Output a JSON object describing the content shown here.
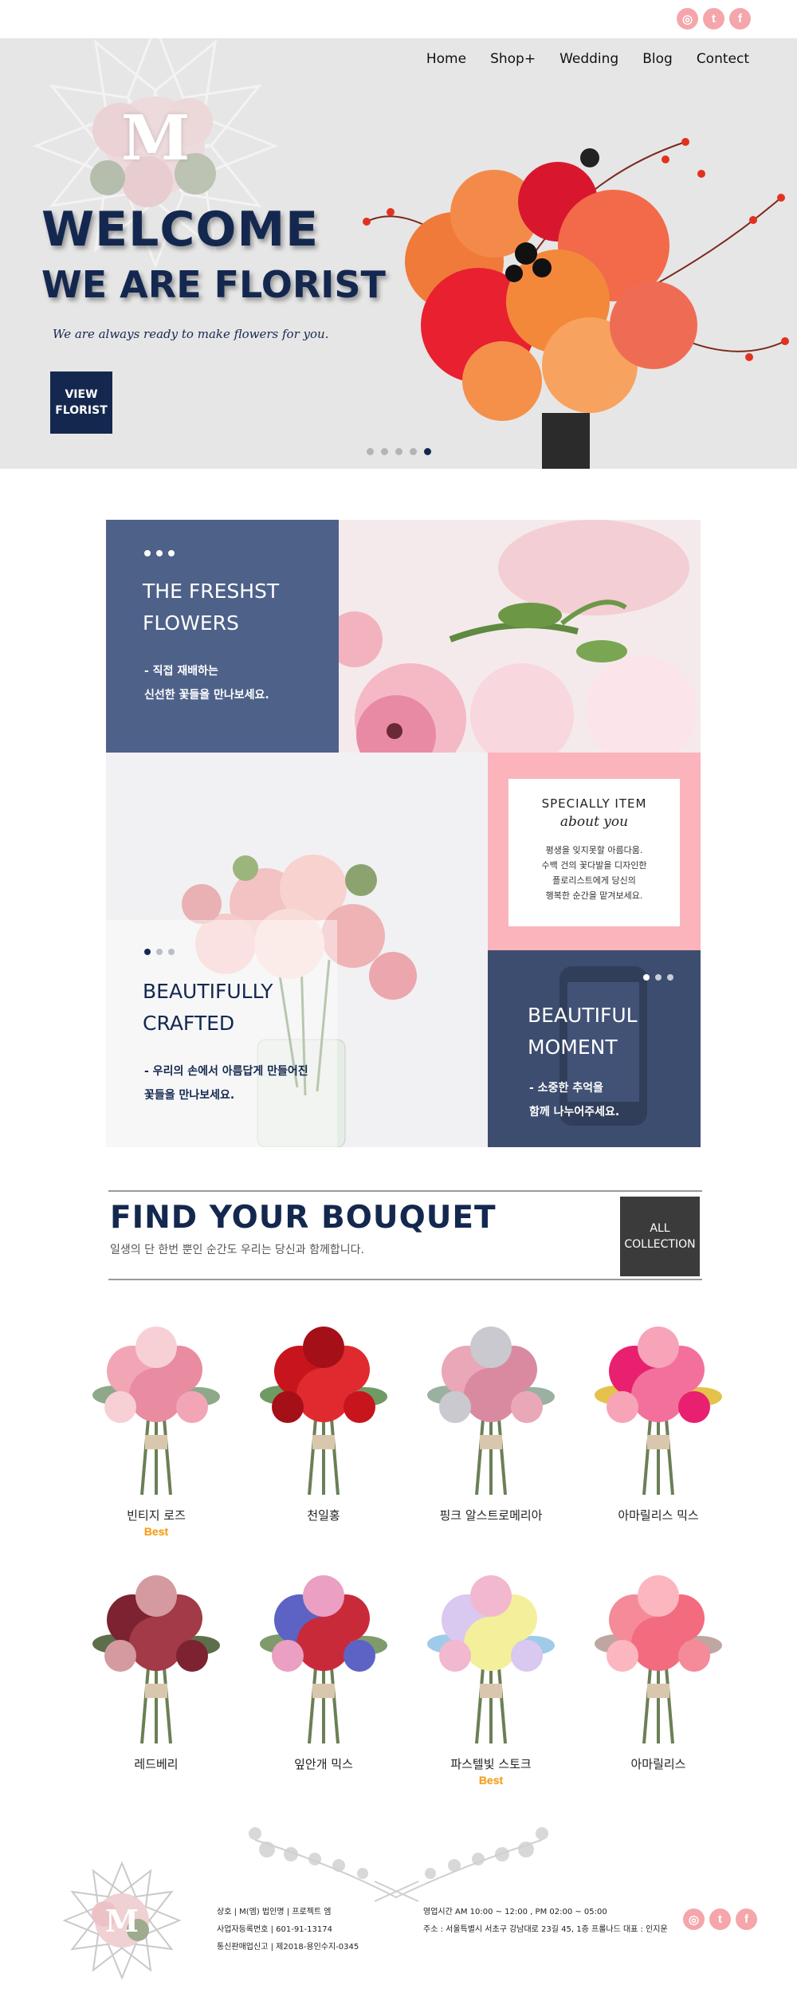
{
  "topbar": {
    "social": [
      {
        "name": "instagram-icon",
        "glyph": "◎"
      },
      {
        "name": "twitter-icon",
        "glyph": "t"
      },
      {
        "name": "facebook-icon",
        "glyph": "f"
      }
    ]
  },
  "hero": {
    "logo_letter": "M",
    "nav": [
      "Home",
      "Shop+",
      "Wedding",
      "Blog",
      "Contect"
    ],
    "title_line1": "WELCOME",
    "title_line2": "WE ARE FLORIST",
    "subtitle": "We are always ready to make flowers for you.",
    "button_line1": "VIEW",
    "button_line2": "FLORIST",
    "slides": 5,
    "active_slide": 5
  },
  "features": {
    "freshest": {
      "title_line1": "THE FRESHST",
      "title_line2": "FLOWERS",
      "text_line1": "- 직접 재배하는",
      "text_line2": "신선한 꽃들을 만나보세요."
    },
    "special": {
      "title": "SPECIALLY ITEM",
      "script": "about you",
      "text_line1": "평생을 잊지못할 아름다움.",
      "text_line2": "수백 건의 꽃다발을 디자인한",
      "text_line3": "플로리스트에게 당신의",
      "text_line4": "행복한 순간을 맡겨보세요."
    },
    "crafted": {
      "title_line1": "BEAUTIFULLY",
      "title_line2": "CRAFTED",
      "text_line1": "- 우리의 손에서 아름답게 만들어진",
      "text_line2": "꽃들을 만나보세요."
    },
    "moment": {
      "title_line1": "BEAUTIFUL",
      "title_line2": "MOMENT",
      "text_line1": "- 소중한 추억을",
      "text_line2": "함께 나누어주세요."
    }
  },
  "bouquet_section": {
    "title": "FIND YOUR BOUQUET",
    "subtitle": "일생의 단 한번 뿐인 순간도 우리는 당신과 함께합니다.",
    "button_line1": "ALL",
    "button_line2": "COLLECTION"
  },
  "products": [
    {
      "name": "빈티지 로즈",
      "badge": "Best",
      "colors": [
        "#f2a5b5",
        "#e98ca1",
        "#f7d0d6",
        "#8fa88a"
      ]
    },
    {
      "name": "천일홍",
      "badge": "",
      "colors": [
        "#c8141d",
        "#e02a2f",
        "#a50f18",
        "#6f9a63"
      ]
    },
    {
      "name": "핑크 알스트로메리아",
      "badge": "",
      "colors": [
        "#e9a7b8",
        "#d98aa0",
        "#c9c9cf",
        "#9bb0a0"
      ]
    },
    {
      "name": "아마릴리스 믹스",
      "badge": "",
      "colors": [
        "#e8206f",
        "#f3709c",
        "#f7a3b8",
        "#e4c24b"
      ]
    },
    {
      "name": "레드베리",
      "badge": "",
      "colors": [
        "#7d2231",
        "#a23a47",
        "#d59aa0",
        "#5d6e4b"
      ]
    },
    {
      "name": "잎안개 믹스",
      "badge": "",
      "colors": [
        "#5c63c4",
        "#c92a3a",
        "#ea9fc3",
        "#7f9b6c"
      ]
    },
    {
      "name": "파스텔빛 스토크",
      "badge": "Best",
      "colors": [
        "#d9c8f0",
        "#f4ef9a",
        "#f2b8cf",
        "#9fcbe8"
      ]
    },
    {
      "name": "아마릴리스",
      "badge": "",
      "colors": [
        "#f58a98",
        "#f36b7f",
        "#fbb6bf",
        "#bfa6a0"
      ]
    }
  ],
  "footer": {
    "logo_letter": "M",
    "company_line1": "상호 | M(엠)   법인명 |   프로젝트 엠",
    "company_line2": "사업자등록번호 | 601-91-13174",
    "company_line3": "통신판매업신고 | 제2018-용인수지-0345",
    "info_line1": "영업시간 AM 10:00 ~ 12:00 , PM 02:00 ~ 05:00",
    "info_line2": "주소 : 서울특별시 서초구 강남대로 23길 45, 1층 프롤나드 대표 : 인지운"
  },
  "colors": {
    "navy": "#14284f",
    "slate": "#4e6189",
    "pink": "#fbb4bc",
    "gold": "#f4a020"
  }
}
